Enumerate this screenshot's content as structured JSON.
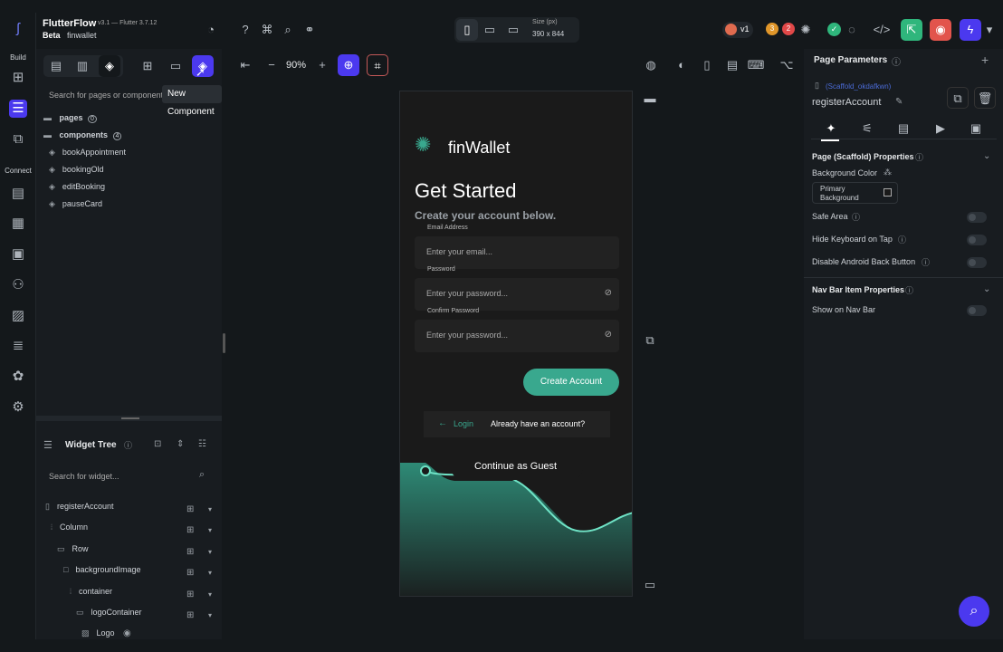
{
  "app": {
    "name": "FlutterFlow",
    "version": "v3.1 — Flutter 3.7.12",
    "badge": "Beta",
    "project": "finwallet"
  },
  "rail": {
    "build_label": "Build",
    "connect_label": "Connect"
  },
  "toolbar": {
    "zoom": "90%",
    "size_label": "Size (px)",
    "size_value": "390 x 844",
    "version": "v1",
    "badge_warnings": "3",
    "badge_errors": "2"
  },
  "left": {
    "search_placeholder": "Search for pages or components...",
    "tooltip": "New Component",
    "pages_label": "pages",
    "pages_count": "0",
    "components_label": "components",
    "components_count": "4",
    "components": [
      "bookAppointment",
      "bookingOld",
      "editBooking",
      "pauseCard"
    ]
  },
  "widget_tree": {
    "title": "Widget Tree",
    "search_placeholder": "Search for widget...",
    "nodes": [
      "registerAccount",
      "Column",
      "Row",
      "backgroundImage",
      "container",
      "logoContainer",
      "Logo"
    ]
  },
  "phone": {
    "logo_text": "finWallet",
    "heading": "Get Started",
    "subheading": "Create your account below.",
    "email_label": "Email Address",
    "email_placeholder": "Enter your email...",
    "password_label": "Password",
    "password_placeholder": "Enter your password...",
    "confirm_label": "Confirm Password",
    "confirm_placeholder": "Enter your password...",
    "create_button": "Create Account",
    "login_label": "Login",
    "already_text": "Already have an account?",
    "guest_text": "Continue as Guest"
  },
  "right": {
    "title": "Page Parameters",
    "scaffold_id": "(Scaffold_okdafkwn)",
    "page_name": "registerAccount",
    "section_page": "Page (Scaffold) Properties",
    "bg_color_label": "Background Color",
    "bg_color_value": "Primary Background",
    "safe_area": "Safe Area",
    "hide_keyboard": "Hide Keyboard on Tap",
    "disable_back": "Disable Android Back Button",
    "section_nav": "Nav Bar Item Properties",
    "show_nav": "Show on Nav Bar"
  },
  "colors": {
    "accent": "#4b39ef",
    "teal": "#39a88e",
    "scaffold_blue": "#4b6bd6"
  }
}
